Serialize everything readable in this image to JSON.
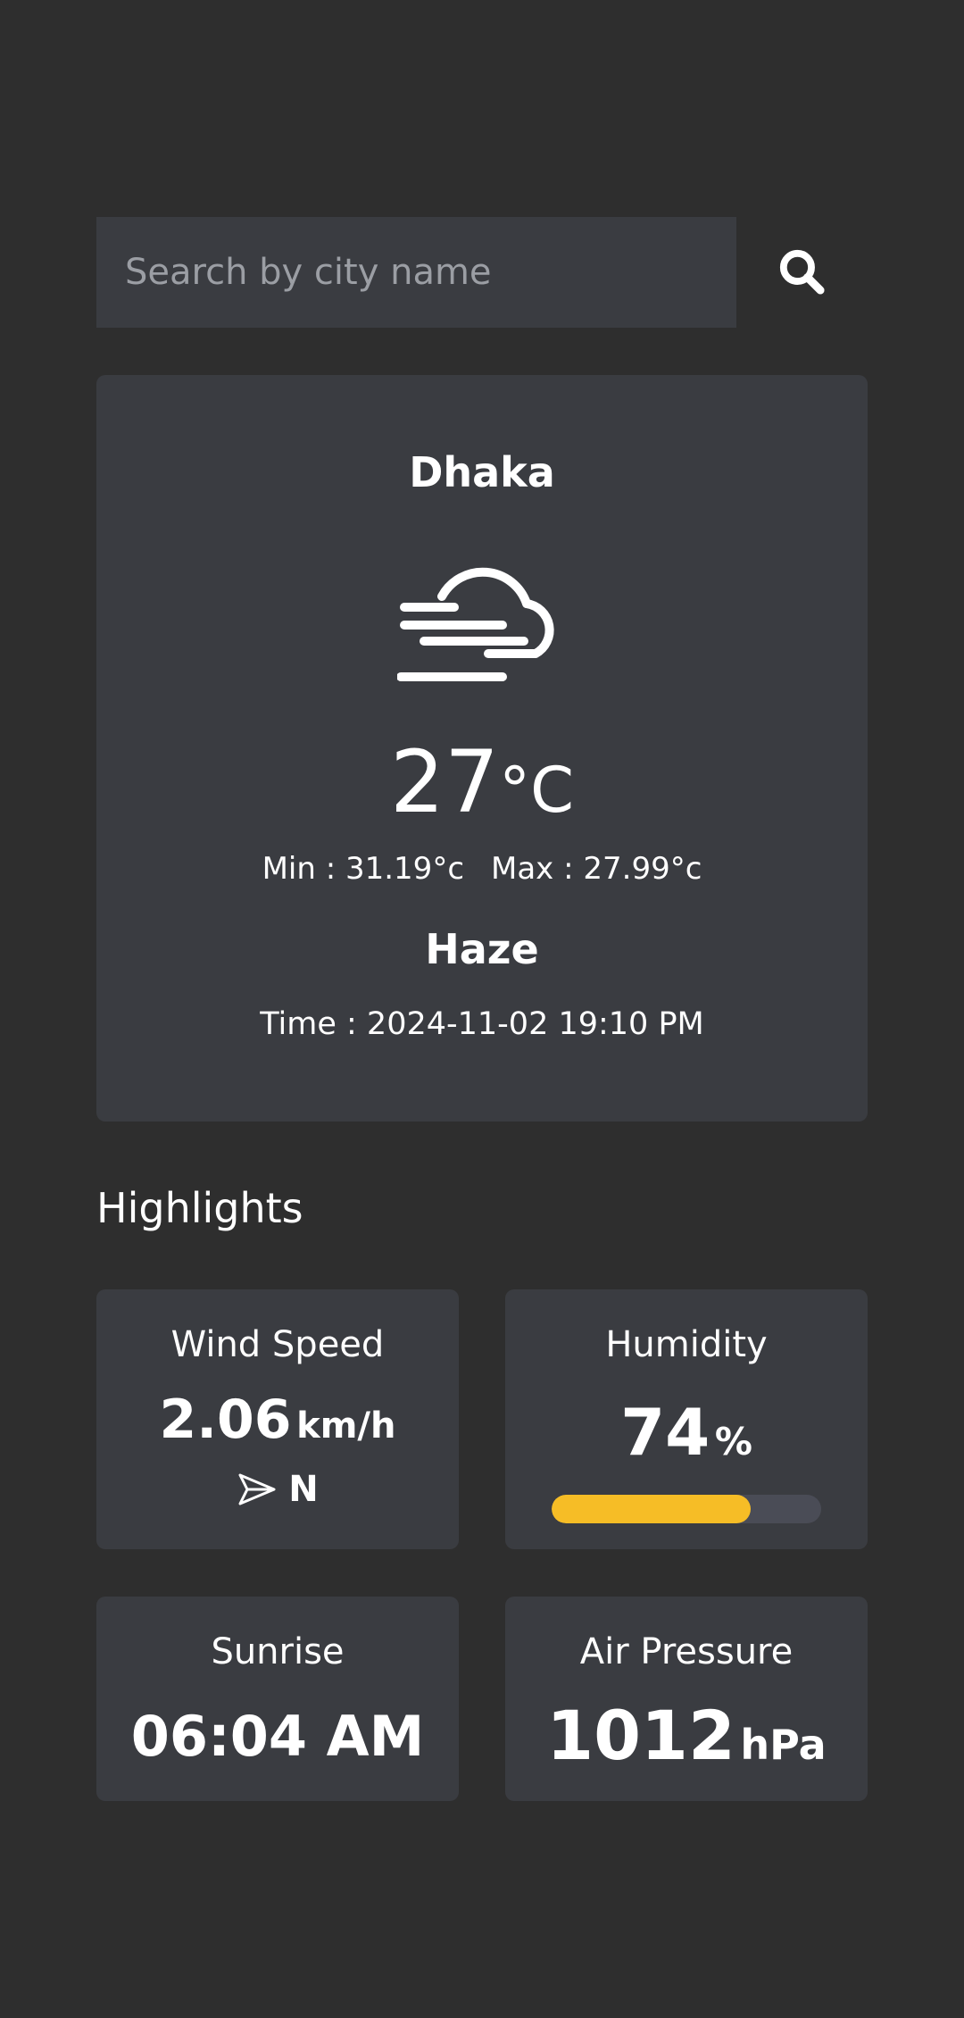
{
  "search": {
    "placeholder": "Search by city name",
    "value": "",
    "button_icon": "search-icon"
  },
  "current": {
    "city": "Dhaka",
    "icon": "haze-cloud-wind-icon",
    "temp": "27",
    "temp_unit": "°C",
    "min_text": "Min : 31.19°c",
    "max_text": "Max : 27.99°c",
    "condition": "Haze",
    "time_text": "Time : 2024-11-02 19:10 PM"
  },
  "highlights": {
    "title": "Highlights",
    "wind": {
      "label": "Wind Speed",
      "value": "2.06",
      "unit": "km/h",
      "direction": "N",
      "direction_icon": "navigation-arrow-icon"
    },
    "humidity": {
      "label": "Humidity",
      "value": "74",
      "unit": "%",
      "percent": 74
    },
    "sunrise": {
      "label": "Sunrise",
      "value": "06:04 AM"
    },
    "pressure": {
      "label": "Air Pressure",
      "value": "1012",
      "unit": "hPa"
    }
  },
  "colors": {
    "background": "#2e2e2e",
    "card": "#3a3c41",
    "accent": "#f6bd26",
    "bar_track": "#4a4c56",
    "text": "#ffffff",
    "placeholder": "#9b9ea4"
  }
}
